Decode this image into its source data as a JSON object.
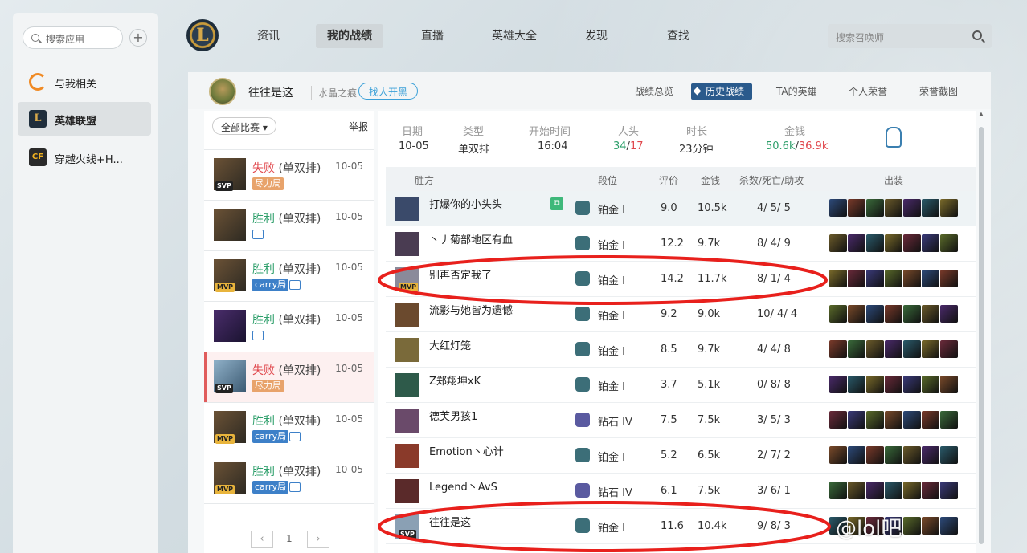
{
  "sidebar": {
    "search_placeholder": "搜索应用",
    "items": [
      {
        "label": "与我相关",
        "icon": "refresh-icon"
      },
      {
        "label": "英雄联盟",
        "icon": "lol-icon"
      },
      {
        "label": "穿越火线+H..."
      }
    ]
  },
  "nav": {
    "tabs": [
      "资讯",
      "我的战绩",
      "直播",
      "英雄大全",
      "发现",
      "查找"
    ],
    "active": "我的战绩",
    "search_placeholder": "搜索召唤师"
  },
  "profile": {
    "name": "往往是这",
    "server": "水晶之痕",
    "blacklist": "找人开黑",
    "tabs": [
      "战绩总览",
      "历史战绩",
      "TA的英雄",
      "个人荣誉",
      "荣誉截图"
    ],
    "active_tab": "历史战绩"
  },
  "list": {
    "filter": "全部比赛",
    "report": "举报",
    "page": "1",
    "games": [
      {
        "result": "失败",
        "type": "(单双排)",
        "date": "10-05",
        "badge": "SVP",
        "tag": "尽力局",
        "win": false
      },
      {
        "result": "胜利",
        "type": "(单双排)",
        "date": "10-05",
        "badge": "",
        "tag": "",
        "win": true
      },
      {
        "result": "胜利",
        "type": "(单双排)",
        "date": "10-05",
        "badge": "MVP",
        "tag": "carry局",
        "win": true
      },
      {
        "result": "胜利",
        "type": "(单双排)",
        "date": "10-05",
        "badge": "",
        "tag": "",
        "win": true
      },
      {
        "result": "失败",
        "type": "(单双排)",
        "date": "10-05",
        "badge": "SVP",
        "tag": "尽力局",
        "win": false
      },
      {
        "result": "胜利",
        "type": "(单双排)",
        "date": "10-05",
        "badge": "MVP",
        "tag": "carry局",
        "win": true
      },
      {
        "result": "胜利",
        "type": "(单双排)",
        "date": "10-05",
        "badge": "MVP",
        "tag": "carry局",
        "win": true
      }
    ]
  },
  "summary": {
    "headers": [
      "日期",
      "类型",
      "开始时间",
      "人头",
      "时长",
      "金钱"
    ],
    "date": "10-05",
    "type": "单双排",
    "start": "16:04",
    "kills_a": "34",
    "kills_b": "17",
    "duration": "23分钟",
    "gold_a": "50.6k",
    "gold_b": "36.9k"
  },
  "table": {
    "headers": [
      "胜方",
      "段位",
      "评价",
      "金钱",
      "杀数/死亡/助攻",
      "出装"
    ],
    "rows": [
      {
        "name": "打爆你的小头头",
        "rank": "铂金 I",
        "score": "9.0",
        "gold": "10.5k",
        "kda": "4/ 5/ 5"
      },
      {
        "name": "丶丿菊部地区有血",
        "rank": "铂金 I",
        "score": "12.2",
        "gold": "9.7k",
        "kda": "8/ 4/ 9"
      },
      {
        "name": "别再否定我了",
        "rank": "铂金 I",
        "score": "14.2",
        "gold": "11.7k",
        "kda": "8/ 1/ 4",
        "badge": "MVP"
      },
      {
        "name": "流影与她皆为遗憾",
        "rank": "铂金 I",
        "score": "9.2",
        "gold": "9.0k",
        "kda": "10/ 4/ 4"
      },
      {
        "name": "大红灯笼",
        "rank": "铂金 I",
        "score": "8.5",
        "gold": "9.7k",
        "kda": "4/ 4/ 8"
      },
      {
        "name": "Z郑翔坤xK",
        "rank": "铂金 I",
        "score": "3.7",
        "gold": "5.1k",
        "kda": "0/ 8/ 8"
      },
      {
        "name": "德芙男孩1",
        "rank": "钻石 IV",
        "score": "7.5",
        "gold": "7.5k",
        "kda": "3/ 5/ 3"
      },
      {
        "name": "Emotion丶心计",
        "rank": "铂金 I",
        "score": "5.2",
        "gold": "6.5k",
        "kda": "2/ 7/ 2"
      },
      {
        "name": "Legend丶AvS",
        "rank": "钻石 IV",
        "score": "6.1",
        "gold": "7.5k",
        "kda": "3/ 6/ 1"
      },
      {
        "name": "往往是这",
        "rank": "铂金 I",
        "score": "11.6",
        "gold": "10.4k",
        "kda": "9/ 8/ 3",
        "badge": "SVP"
      }
    ]
  },
  "watermark": "@lol吧"
}
